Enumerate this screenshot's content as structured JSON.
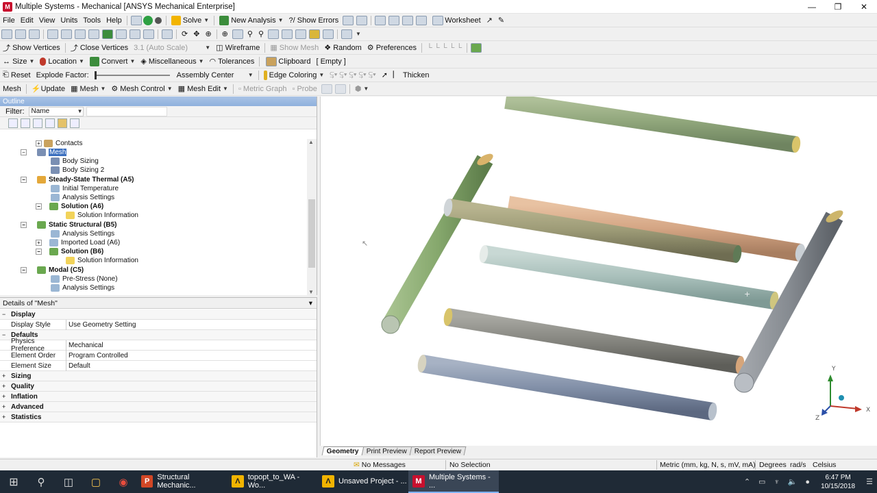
{
  "window": {
    "title": "Multiple Systems - Mechanical [ANSYS Mechanical Enterprise]"
  },
  "menu": [
    "File",
    "Edit",
    "View",
    "Units",
    "Tools",
    "Help"
  ],
  "toolbar1": {
    "solve": "Solve",
    "new_analysis": "New Analysis",
    "show_errors": "?/ Show Errors",
    "worksheet": "Worksheet"
  },
  "toolbar2": {
    "show_vertices": "Show Vertices",
    "close_vertices": "Close Vertices",
    "scale": "3.1 (Auto Scale)",
    "wireframe": "Wireframe",
    "show_mesh": "Show Mesh",
    "random": "Random",
    "preferences": "Preferences"
  },
  "toolbar3": {
    "size": "Size",
    "location": "Location",
    "convert": "Convert",
    "miscellaneous": "Miscellaneous",
    "tolerances": "Tolerances",
    "clipboard": "Clipboard",
    "clipboard_value": "[ Empty ]"
  },
  "toolbar4": {
    "reset": "Reset",
    "explode_factor": "Explode Factor:",
    "assembly_center": "Assembly Center",
    "edge_coloring": "Edge Coloring",
    "thicken": "Thicken"
  },
  "toolbar5": {
    "mesh": "Mesh",
    "update": "Update",
    "mesh_dd": "Mesh",
    "mesh_control": "Mesh Control",
    "mesh_edit": "Mesh Edit",
    "metric_graph": "Metric Graph",
    "probe": "Probe"
  },
  "outline": {
    "title": "Outline",
    "filter_label": "Filter:",
    "filter_value": "Name",
    "tree": [
      {
        "label": "Contacts",
        "bold": false
      },
      {
        "label": "Mesh",
        "bold": false,
        "selected": true
      },
      {
        "label": "Body Sizing",
        "bold": false
      },
      {
        "label": "Body Sizing 2",
        "bold": false
      },
      {
        "label": "Steady-State Thermal (A5)",
        "bold": true
      },
      {
        "label": "Initial Temperature",
        "bold": false
      },
      {
        "label": "Analysis Settings",
        "bold": false
      },
      {
        "label": "Solution (A6)",
        "bold": true
      },
      {
        "label": "Solution Information",
        "bold": false
      },
      {
        "label": "Static Structural (B5)",
        "bold": true
      },
      {
        "label": "Analysis Settings",
        "bold": false
      },
      {
        "label": "Imported Load (A6)",
        "bold": false
      },
      {
        "label": "Solution (B6)",
        "bold": true
      },
      {
        "label": "Solution Information",
        "bold": false
      },
      {
        "label": "Modal (C5)",
        "bold": true
      },
      {
        "label": "Pre-Stress (None)",
        "bold": false
      },
      {
        "label": "Analysis Settings",
        "bold": false
      }
    ]
  },
  "details": {
    "title": "Details of \"Mesh\"",
    "pin": "▾",
    "rows": [
      {
        "key": "Display",
        "value": "",
        "category": true,
        "sign": "−"
      },
      {
        "key": "Display Style",
        "value": "Use Geometry Setting",
        "category": false
      },
      {
        "key": "Defaults",
        "value": "",
        "category": true,
        "sign": "−"
      },
      {
        "key": "Physics Preference",
        "value": "Mechanical",
        "category": false
      },
      {
        "key": "Element Order",
        "value": "Program Controlled",
        "category": false
      },
      {
        "key": "Element Size",
        "value": "Default",
        "category": false
      },
      {
        "key": "Sizing",
        "value": "",
        "category": true,
        "sign": "+"
      },
      {
        "key": "Quality",
        "value": "",
        "category": true,
        "sign": "+"
      },
      {
        "key": "Inflation",
        "value": "",
        "category": true,
        "sign": "+"
      },
      {
        "key": "Advanced",
        "value": "",
        "category": true,
        "sign": "+"
      },
      {
        "key": "Statistics",
        "value": "",
        "category": true,
        "sign": "+"
      }
    ]
  },
  "viewport": {
    "tabs": [
      "Geometry",
      "Print Preview",
      "Report Preview"
    ],
    "active_tab": 0,
    "triad": {
      "y": "Y",
      "x": "X",
      "z": "Z"
    }
  },
  "status": {
    "messages": "No Messages",
    "selection": "No Selection",
    "units": "Metric (mm, kg, N, s, mV, mA)",
    "angle": "Degrees",
    "rate": "rad/s",
    "temp": "Celsius"
  },
  "taskbar": {
    "tasks": [
      {
        "label": "Structural Mechanic...",
        "color": "#d24726",
        "glyph": "P"
      },
      {
        "label": "topopt_to_WA - Wo...",
        "color": "#f2b400",
        "glyph": "Λ"
      },
      {
        "label": "Unsaved Project - ...",
        "color": "#f2b400",
        "glyph": "Λ"
      },
      {
        "label": "Multiple Systems - ...",
        "color": "#c8102e",
        "glyph": "M",
        "active": true
      }
    ],
    "time": "6:47 PM",
    "date": "10/15/2018"
  }
}
